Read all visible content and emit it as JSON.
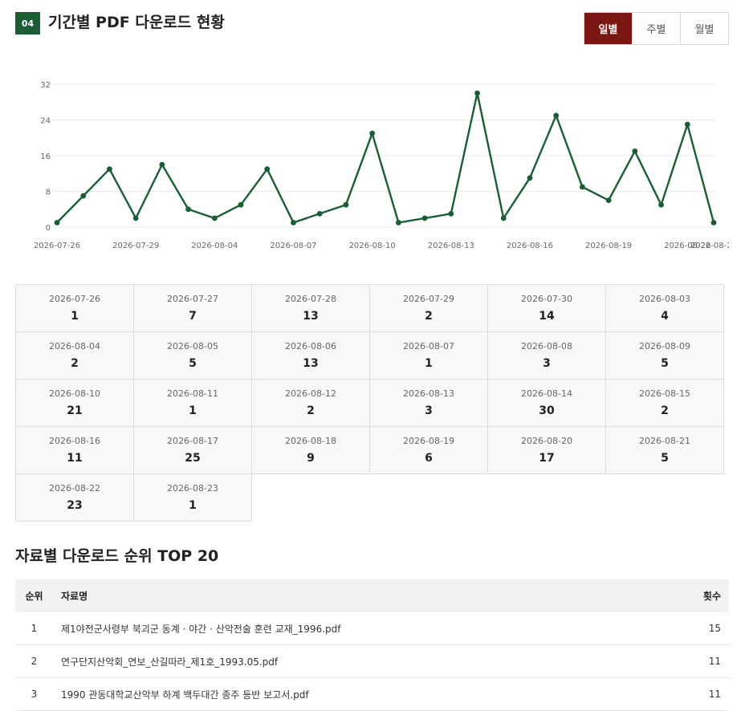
{
  "section": {
    "badge": "04",
    "title": "기간별 PDF 다운로드 현황",
    "tabs": [
      "일별",
      "주별",
      "월별"
    ],
    "active_tab": "일별"
  },
  "colors": {
    "line": "#1b5e35",
    "badge": "#1b5e35",
    "active_tab": "#7a1712",
    "grid": "#e8e8e8"
  },
  "chart_data": {
    "type": "line",
    "x": [
      "2026-07-26",
      "2026-07-27",
      "2026-07-28",
      "2026-07-29",
      "2026-07-30",
      "2026-08-03",
      "2026-08-04",
      "2026-08-05",
      "2026-08-06",
      "2026-08-07",
      "2026-08-08",
      "2026-08-09",
      "2026-08-10",
      "2026-08-11",
      "2026-08-12",
      "2026-08-13",
      "2026-08-14",
      "2026-08-15",
      "2026-08-16",
      "2026-08-17",
      "2026-08-18",
      "2026-08-19",
      "2026-08-20",
      "2026-08-21",
      "2026-08-22",
      "2026-08-23"
    ],
    "series": [
      {
        "values": [
          1,
          7,
          13,
          2,
          14,
          4,
          2,
          5,
          13,
          1,
          3,
          5,
          21,
          1,
          2,
          3,
          30,
          2,
          11,
          25,
          9,
          6,
          17,
          5,
          23,
          1
        ]
      }
    ],
    "y_ticks": [
      0,
      8,
      16,
      24,
      32
    ],
    "x_tick_labels": [
      "2026-07-26",
      "2026-07-29",
      "2026-08-04",
      "2026-08-07",
      "2026-08-10",
      "2026-08-13",
      "2026-08-16",
      "2026-08-19",
      "2026-08-22",
      "2026-08-23"
    ],
    "ylim": [
      0,
      32
    ],
    "grid": true,
    "title": "",
    "xlabel": "",
    "ylabel": ""
  },
  "daily_counts": [
    {
      "date": "2026-07-26",
      "count": "1"
    },
    {
      "date": "2026-07-27",
      "count": "7"
    },
    {
      "date": "2026-07-28",
      "count": "13"
    },
    {
      "date": "2026-07-29",
      "count": "2"
    },
    {
      "date": "2026-07-30",
      "count": "14"
    },
    {
      "date": "2026-08-03",
      "count": "4"
    },
    {
      "date": "2026-08-04",
      "count": "2"
    },
    {
      "date": "2026-08-05",
      "count": "5"
    },
    {
      "date": "2026-08-06",
      "count": "13"
    },
    {
      "date": "2026-08-07",
      "count": "1"
    },
    {
      "date": "2026-08-08",
      "count": "3"
    },
    {
      "date": "2026-08-09",
      "count": "5"
    },
    {
      "date": "2026-08-10",
      "count": "21"
    },
    {
      "date": "2026-08-11",
      "count": "1"
    },
    {
      "date": "2026-08-12",
      "count": "2"
    },
    {
      "date": "2026-08-13",
      "count": "3"
    },
    {
      "date": "2026-08-14",
      "count": "30"
    },
    {
      "date": "2026-08-15",
      "count": "2"
    },
    {
      "date": "2026-08-16",
      "count": "11"
    },
    {
      "date": "2026-08-17",
      "count": "25"
    },
    {
      "date": "2026-08-18",
      "count": "9"
    },
    {
      "date": "2026-08-19",
      "count": "6"
    },
    {
      "date": "2026-08-20",
      "count": "17"
    },
    {
      "date": "2026-08-21",
      "count": "5"
    },
    {
      "date": "2026-08-22",
      "count": "23"
    },
    {
      "date": "2026-08-23",
      "count": "1"
    }
  ],
  "ranking": {
    "title": "자료별 다운로드 순위 TOP 20",
    "headers": {
      "rank": "순위",
      "title": "자료명",
      "count": "횟수"
    },
    "rows": [
      {
        "rank": "1",
        "title": "제1야전군사령부 북괴군 동계 · 야간 · 산악전술 훈련 교재_1996.pdf",
        "count": "15"
      },
      {
        "rank": "2",
        "title": "연구단지산악회_연보_산길따라_제1호_1993.05.pdf",
        "count": "11"
      },
      {
        "rank": "3",
        "title": "1990 관동대학교산악부 하계 백두대간 종주 등반 보고서.pdf",
        "count": "11"
      }
    ]
  }
}
